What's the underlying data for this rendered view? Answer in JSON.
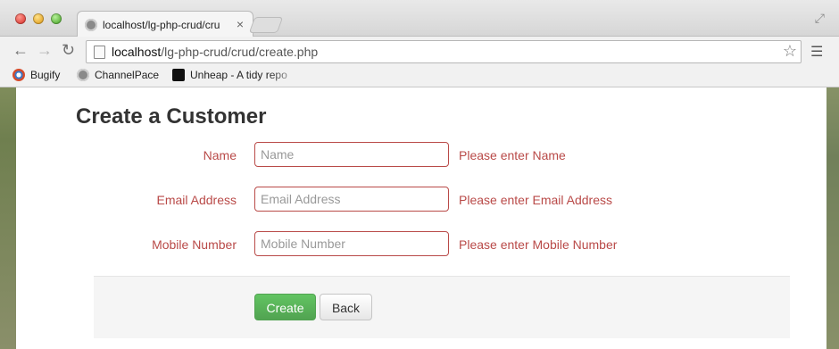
{
  "browser": {
    "tab_title": "localhost/lg-php-crud/cru",
    "tab_close": "×",
    "url_host": "localhost",
    "url_path": "/lg-php-crud/crud/create.php",
    "bookmarks": [
      {
        "label": "Bugify",
        "icon": "bugify-icon"
      },
      {
        "label": "ChannelPace",
        "icon": "globe-icon"
      },
      {
        "label": "Unheap - A tidy repo",
        "icon": "unheap-icon"
      }
    ]
  },
  "page": {
    "title": "Create a Customer",
    "fields": [
      {
        "label": "Name",
        "placeholder": "Name",
        "value": "",
        "error": "Please enter Name"
      },
      {
        "label": "Email Address",
        "placeholder": "Email Address",
        "value": "",
        "error": "Please enter Email Address"
      },
      {
        "label": "Mobile Number",
        "placeholder": "Mobile Number",
        "value": "",
        "error": "Please enter Mobile Number"
      }
    ],
    "buttons": {
      "create": "Create",
      "back": "Back"
    }
  },
  "colors": {
    "error": "#b94a48",
    "success_button": "#5cb85c",
    "form_actions_bg": "#f5f5f5"
  }
}
